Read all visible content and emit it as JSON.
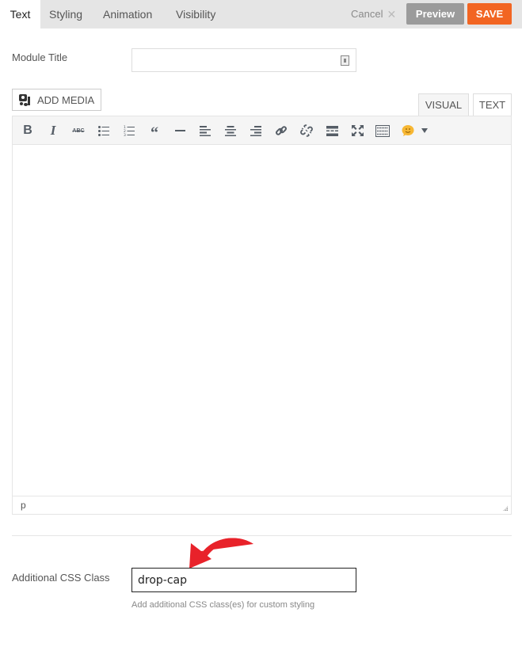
{
  "tabs": [
    {
      "label": "Text",
      "active": true
    },
    {
      "label": "Styling",
      "active": false
    },
    {
      "label": "Animation",
      "active": false
    },
    {
      "label": "Visibility",
      "active": false
    }
  ],
  "actions": {
    "cancel_label": "Cancel",
    "preview_label": "Preview",
    "save_label": "SAVE"
  },
  "colors": {
    "save": "#f26522",
    "preview": "#9b9b9b",
    "annotation_arrow": "#e8222a"
  },
  "module_title": {
    "label": "Module Title",
    "value": "",
    "placeholder": ""
  },
  "editor": {
    "add_media_label": "ADD MEDIA",
    "mode_tabs": {
      "visual": "VISUAL",
      "text": "TEXT"
    },
    "toolbar": [
      "bold",
      "italic",
      "strikethrough",
      "bulleted-list",
      "numbered-list",
      "blockquote",
      "horizontal-line",
      "align-left",
      "align-center",
      "align-right",
      "insert-link",
      "remove-link",
      "read-more",
      "fullscreen",
      "toolbar-toggle",
      "emoji"
    ],
    "content": "",
    "path": "p"
  },
  "css_class": {
    "label": "Additional CSS Class",
    "value": "drop-cap",
    "help": "Add additional CSS class(es) for custom styling"
  }
}
